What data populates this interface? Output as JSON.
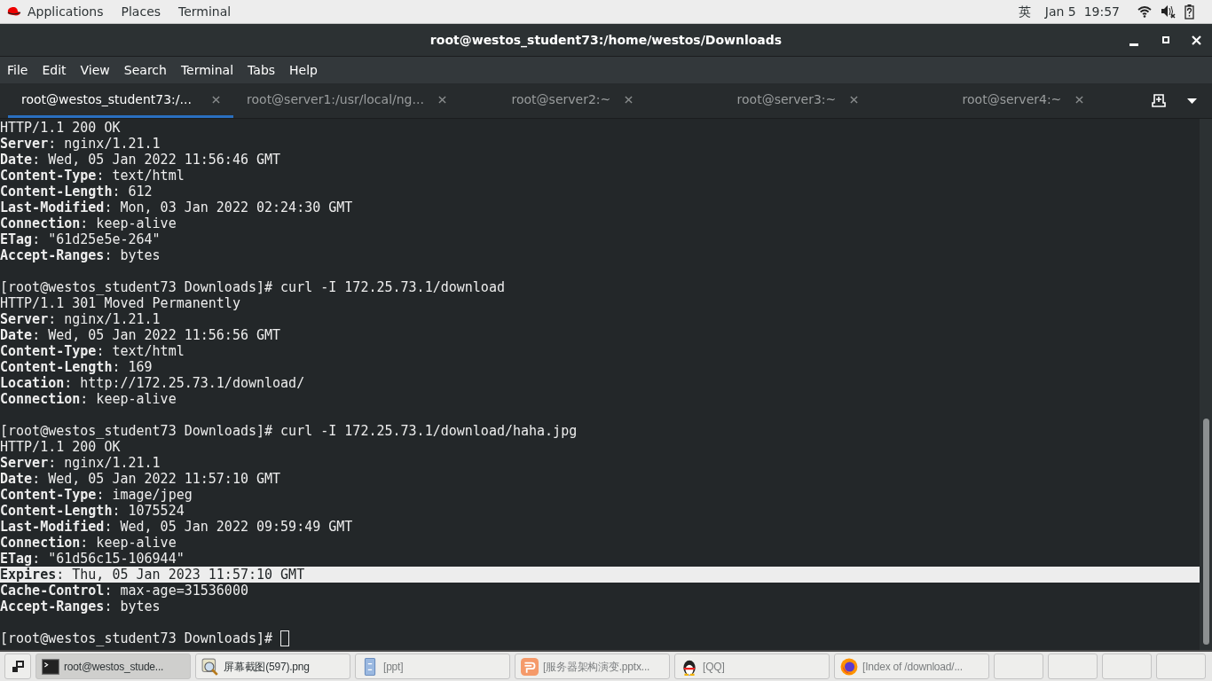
{
  "top_bar": {
    "menus": [
      "Applications",
      "Places",
      "Terminal"
    ],
    "input_method": "英",
    "clock": "Jan 5  19:57"
  },
  "window": {
    "title": "root@westos_student73:/home/westos/Downloads"
  },
  "menu_bar": [
    "File",
    "Edit",
    "View",
    "Search",
    "Terminal",
    "Tabs",
    "Help"
  ],
  "tabs": [
    {
      "label": "root@westos_student73:/...",
      "selected": true
    },
    {
      "label": "root@server1:/usr/local/ng...",
      "selected": false
    },
    {
      "label": "root@server2:~",
      "selected": false
    },
    {
      "label": "root@server3:~",
      "selected": false
    },
    {
      "label": "root@server4:~",
      "selected": false
    }
  ],
  "terminal": {
    "lines": [
      {
        "kind": "text",
        "text": "HTTP/1.1 200 OK",
        "highlighted": false
      },
      {
        "kind": "header",
        "text": "**Server**: nginx/1.21.1",
        "highlighted": false
      },
      {
        "kind": "header",
        "text": "**Date**: Wed, 05 Jan 2022 11:56:46 GMT",
        "highlighted": false
      },
      {
        "kind": "header",
        "text": "**Content-Type**: text/html",
        "highlighted": false
      },
      {
        "kind": "header",
        "text": "**Content-Length**: 612",
        "highlighted": false
      },
      {
        "kind": "header",
        "text": "**Last-Modified**: Mon, 03 Jan 2022 02:24:30 GMT",
        "highlighted": false
      },
      {
        "kind": "header",
        "text": "**Connection**: keep-alive",
        "highlighted": false
      },
      {
        "kind": "header",
        "text": "**ETag**: \"61d25e5e-264\"",
        "highlighted": false
      },
      {
        "kind": "header",
        "text": "**Accept-Ranges**: bytes",
        "highlighted": false
      },
      {
        "kind": "blank",
        "highlighted": false
      },
      {
        "kind": "text",
        "text": "[root@westos_student73 Downloads]# curl -I 172.25.73.1/download",
        "highlighted": false
      },
      {
        "kind": "text",
        "text": "HTTP/1.1 301 Moved Permanently",
        "highlighted": false
      },
      {
        "kind": "header",
        "text": "**Server**: nginx/1.21.1",
        "highlighted": false
      },
      {
        "kind": "header",
        "text": "**Date**: Wed, 05 Jan 2022 11:56:56 GMT",
        "highlighted": false
      },
      {
        "kind": "header",
        "text": "**Content-Type**: text/html",
        "highlighted": false
      },
      {
        "kind": "header",
        "text": "**Content-Length**: 169",
        "highlighted": false
      },
      {
        "kind": "header",
        "text": "**Location**: http://172.25.73.1/download/",
        "highlighted": false
      },
      {
        "kind": "header",
        "text": "**Connection**: keep-alive",
        "highlighted": false
      },
      {
        "kind": "blank",
        "highlighted": false
      },
      {
        "kind": "text",
        "text": "[root@westos_student73 Downloads]# curl -I 172.25.73.1/download/haha.jpg",
        "highlighted": false
      },
      {
        "kind": "text",
        "text": "HTTP/1.1 200 OK",
        "highlighted": false
      },
      {
        "kind": "header",
        "text": "**Server**: nginx/1.21.1",
        "highlighted": false
      },
      {
        "kind": "header",
        "text": "**Date**: Wed, 05 Jan 2022 11:57:10 GMT",
        "highlighted": false
      },
      {
        "kind": "header",
        "text": "**Content-Type**: image/jpeg",
        "highlighted": false
      },
      {
        "kind": "header",
        "text": "**Content-Length**: 1075524",
        "highlighted": false
      },
      {
        "kind": "header",
        "text": "**Last-Modified**: Wed, 05 Jan 2022 09:59:49 GMT",
        "highlighted": false
      },
      {
        "kind": "header",
        "text": "**Connection**: keep-alive",
        "highlighted": false
      },
      {
        "kind": "header",
        "text": "**ETag**: \"61d56c15-106944\"",
        "highlighted": false
      },
      {
        "kind": "header",
        "text": "**Expires**: Thu, 05 Jan 2023 11:57:10 GMT",
        "highlighted": true
      },
      {
        "kind": "header",
        "text": "**Cache-Control**: max-age=31536000",
        "highlighted": false
      },
      {
        "kind": "header",
        "text": "**Accept-Ranges**: bytes",
        "highlighted": false
      },
      {
        "kind": "blank",
        "highlighted": false
      },
      {
        "kind": "prompt",
        "text": "[root@westos_student73 Downloads]#",
        "highlighted": false
      }
    ]
  },
  "taskbar": [
    {
      "kind": "terminal",
      "label": "root@westos_stude...",
      "selected": true
    },
    {
      "kind": "image",
      "label": "屏幕截图(597).png",
      "selected": false
    },
    {
      "kind": "folder",
      "label": "[ppt]",
      "selected": false
    },
    {
      "kind": "slides",
      "label": "[服务器架构演变.pptx...",
      "selected": false
    },
    {
      "kind": "qq",
      "label": "[QQ]",
      "selected": false
    },
    {
      "kind": "browser",
      "label": "[Index of /download/...",
      "selected": false
    },
    {
      "kind": "empty",
      "selected": false
    },
    {
      "kind": "empty",
      "selected": false
    },
    {
      "kind": "empty",
      "selected": false
    },
    {
      "kind": "empty",
      "selected": false
    }
  ]
}
